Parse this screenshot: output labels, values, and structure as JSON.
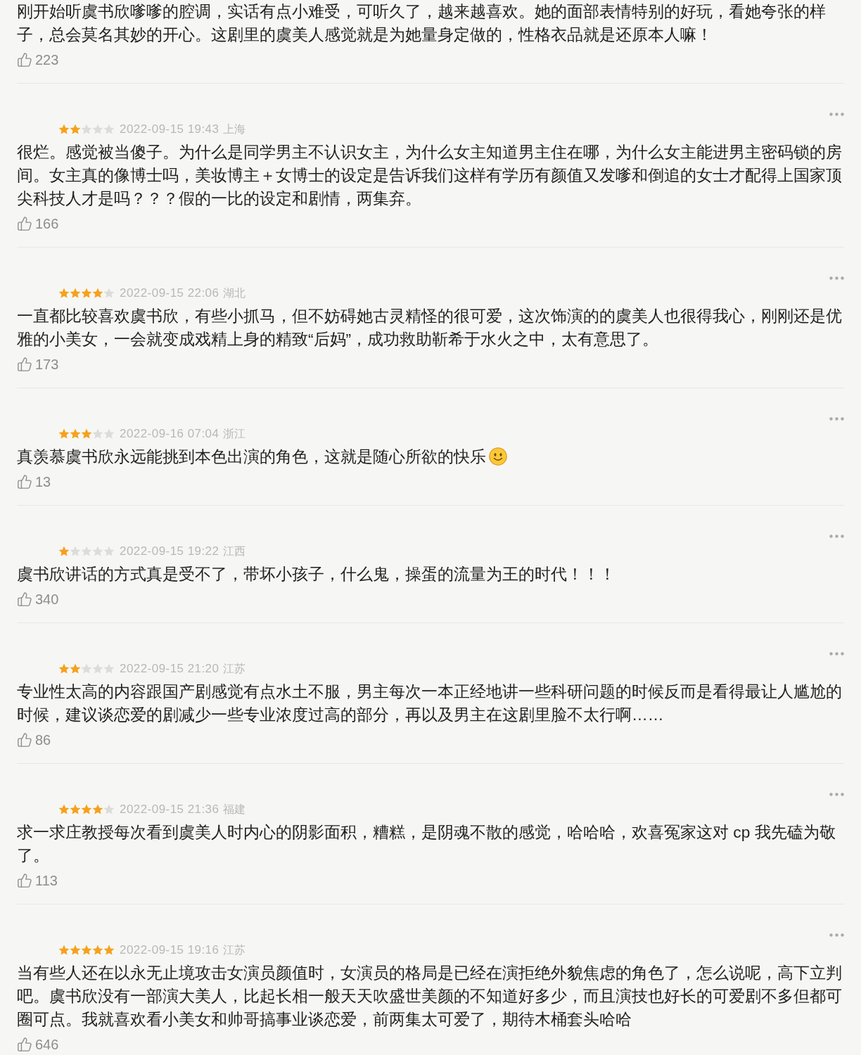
{
  "reviews": [
    {
      "text": "刚开始听虞书欣嗲嗲的腔调，实话有点小难受，可听久了，越来越喜欢。她的面部表情特别的好玩，看她夸张的样子，总会莫名其妙的开心。这剧里的虞美人感觉就是为她量身定做的，性格衣品就是还原本人嘛！",
      "likes": "223"
    },
    {
      "stars": 2,
      "date": "2022-09-15 19:43",
      "location": "上海",
      "text": "很烂。感觉被当傻子。为什么是同学男主不认识女主，为什么女主知道男主住在哪，为什么女主能进男主密码锁的房间。女主真的像博士吗，美妆博主＋女博士的设定是告诉我们这样有学历有颜值又发嗲和倒追的女士才配得上国家顶尖科技人才是吗？？？假的一比的设定和剧情，两集弃。",
      "likes": "166"
    },
    {
      "stars": 4,
      "date": "2022-09-15 22:06",
      "location": "湖北",
      "text": "一直都比较喜欢虞书欣，有些小抓马，但不妨碍她古灵精怪的很可爱，这次饰演的的虞美人也很得我心，刚刚还是优雅的小美女，一会就变成戏精上身的精致“后妈”，成功救助靳希于水火之中，太有意思了。",
      "likes": "173"
    },
    {
      "stars": 3,
      "date": "2022-09-16 07:04",
      "location": "浙江",
      "text": "真羡慕虞书欣永远能挑到本色出演的角色，这就是随心所欲的快乐",
      "smiley": true,
      "likes": "13"
    },
    {
      "stars": 1,
      "date": "2022-09-15 19:22",
      "location": "江西",
      "text": "虞书欣讲话的方式真是受不了，带坏小孩子，什么鬼，操蛋的流量为王的时代！！！",
      "likes": "340"
    },
    {
      "stars": 2,
      "date": "2022-09-15 21:20",
      "location": "江苏",
      "text": "专业性太高的内容跟国产剧感觉有点水土不服，男主每次一本正经地讲一些科研问题的时候反而是看得最让人尴尬的时候，建议谈恋爱的剧减少一些专业浓度过高的部分，再以及男主在这剧里脸不太行啊……",
      "likes": "86"
    },
    {
      "stars": 4,
      "date": "2022-09-15 21:36",
      "location": "福建",
      "text": "求一求庄教授每次看到虞美人时内心的阴影面积，糟糕，是阴魂不散的感觉，哈哈哈，欢喜冤家这对 cp 我先磕为敬了。",
      "likes": "113"
    },
    {
      "stars": 5,
      "date": "2022-09-15 19:16",
      "location": "江苏",
      "text": "当有些人还在以永无止境攻击女演员颜值时，女演员的格局是已经在演拒绝外貌焦虑的角色了，怎么说呢，高下立判吧。虞书欣没有一部演大美人，比起长相一般天天吹盛世美颜的不知道好多少，而且演技也好长的可爱剧不多但都可圈可点。我就喜欢看小美女和帅哥搞事业谈恋爱，前两集太可爱了，期待木桶套头哈哈",
      "likes": "646"
    }
  ]
}
